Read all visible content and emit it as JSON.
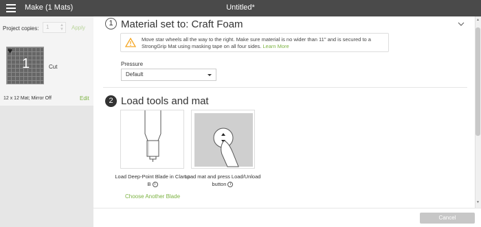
{
  "header": {
    "app_title": "Make (1 Mats)",
    "doc_title": "Untitled*"
  },
  "sidebar": {
    "copies_label": "Project copies:",
    "copies_value": "1",
    "apply_label": "Apply",
    "mat_number": "1",
    "mat_operation": "Cut",
    "mat_info": "12 x 12 Mat; Mirror Off",
    "edit_label": "Edit"
  },
  "main": {
    "step1": {
      "number": "1",
      "title": "Material set to: Craft Foam",
      "warning_text": "Move star wheels all the way to the right. Make sure material is no wider than 11\" and is secured to a StrongGrip Mat using masking tape on all four sides.",
      "learn_more": "Learn More",
      "pressure_label": "Pressure",
      "pressure_value": "Default"
    },
    "step2": {
      "number": "2",
      "title": "Load tools and mat",
      "card1_caption": "Load Deep-Point Blade in Clamp B",
      "card2_caption": "Load mat and press Load/Unload button",
      "choose_blade": "Choose Another Blade",
      "info_glyph": "i"
    }
  },
  "footer": {
    "cancel_label": "Cancel"
  },
  "colors": {
    "topbar": "#4a4a4a",
    "accent_green": "#7bb241",
    "warning_orange": "#f5a623",
    "cancel_bg": "#c7c7c7"
  },
  "icons": {
    "menu": "hamburger-icon",
    "warning": "warning-icon",
    "collapse": "chevron-down-icon",
    "info": "info-icon"
  }
}
